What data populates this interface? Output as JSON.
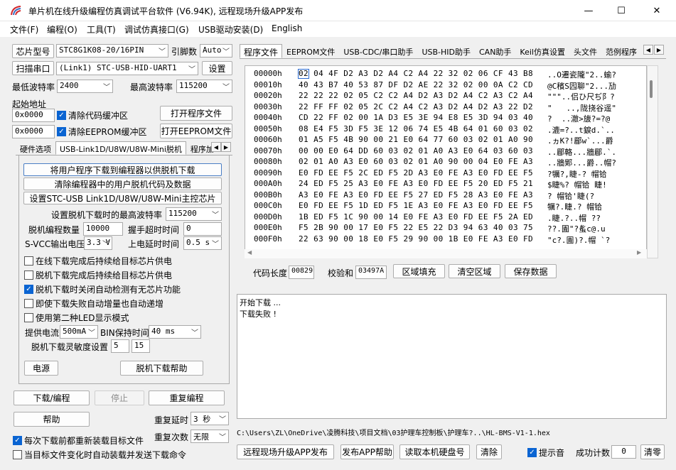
{
  "window": {
    "title": "单片机在线升级编程仿真调试平台软件 (V6.94K), 远程现场升级APP发布",
    "min": "—",
    "max": "☐",
    "close": "✕"
  },
  "menu": [
    "文件(F)",
    "编程(O)",
    "工具(T)",
    "调试仿真接口(G)",
    "USB驱动安装(D)",
    "English"
  ],
  "left": {
    "mcu_btn": "芯片型号",
    "mcu_value": "STC8G1K08-20/16PIN",
    "pin_label": "引脚数",
    "pin_value": "Auto",
    "scan_btn": "扫描串口",
    "port_value": "(Link1) STC-USB-HID-UART1",
    "settings_btn": "设置",
    "min_baud_label": "最低波特率",
    "min_baud": "2400",
    "max_baud_label": "最高波特率",
    "max_baud": "115200",
    "start_addr_label": "起始地址",
    "addr1": "0x0000",
    "clear_code_label": "清除代码缓冲区",
    "open_prog_btn": "打开程序文件",
    "addr2": "0x0000",
    "clear_eeprom_label": "清除EEPROM缓冲区",
    "open_eeprom_btn": "打开EEPROM文件",
    "tabs": [
      "硬件选项",
      "USB-Link1D/U8W/U8W-Mini脱机",
      "程序加"
    ],
    "offline_btn1": "将用户程序下载到编程器以供脱机下载",
    "offline_btn2": "清除编程器中的用户脱机代码及数据",
    "offline_btn3": "设置STC-USB Link1D/U8W/U8W-Mini主控芯片",
    "max_baud_offline_label": "设置脱机下载时的最高波特率",
    "max_baud_offline": "115200",
    "offline_count_label": "脱机编程数量",
    "offline_count": "10000",
    "handshake_label": "握手超时时间",
    "handshake": "0",
    "svcc_label": "S-VCC输出电压",
    "svcc": "3.3 V",
    "poweron_label": "上电延时时间",
    "poweron": "0.5 s",
    "opt1": "在线下载完成后持续给目标芯片供电",
    "opt2": "脱机下载完成后持续给目标芯片供电",
    "opt3": "脱机下载时关闭自动检测有无芯片功能",
    "opt4": "即使下载失败自动增量也自动递增",
    "opt5": "使用第二种LED显示模式",
    "current_label": "提供电流",
    "current": "500mA",
    "bin_label": "BIN保持时间",
    "bin": "40 ms",
    "sensitivity_label": "脱机下载灵敏度设置",
    "sens1": "5",
    "sens2": "15",
    "power_btn": "电源",
    "offline_help_btn": "脱机下载帮助",
    "download_btn": "下载/编程",
    "stop_btn": "停止",
    "reprogram_btn": "重复编程",
    "help_btn": "帮助",
    "repeat_delay_label": "重复延时",
    "repeat_delay": "3 秒",
    "repeat_count_label": "重复次数",
    "repeat_count": "无限",
    "reload_label": "每次下载前都重新装载目标文件",
    "autoload_label": "当目标文件变化时自动装载并发送下载命令"
  },
  "right": {
    "tabs": [
      "程序文件",
      "EEPROM文件",
      "USB-CDC/串口助手",
      "USB-HID助手",
      "CAN助手",
      "Keil仿真设置",
      "头文件",
      "范例程序"
    ],
    "hex_rows": [
      {
        "addr": "00000h",
        "bytes": "02 04 4F D2 A3 D2 A4 C2 A4 22 32 02 06 CF 43 B8",
        "ascii": "..O遷瓷隴\"2..蝓?"
      },
      {
        "addr": "00010h",
        "bytes": "40 43 B7 40 53 87 DF D2 AE 22 32 02 00 0A C2 CD",
        "ascii": "@C穦S囥聊\"2...劢"
      },
      {
        "addr": "00020h",
        "bytes": "22 22 22 02 05 C2 C2 A4 D2 A3 D2 A4 C2 A3 C2 A4",
        "ascii": "\"\"\"..侣ひ尺ぢ阝?"
      },
      {
        "addr": "00030h",
        "bytes": "22 FF FF 02 05 2C C2 A4 C2 A3 D2 A4 D2 A3 22 D2",
        "ascii": "\"   ..,陇挠谷遥\""
      },
      {
        "addr": "00040h",
        "bytes": "CD 22 FF 02 00 1A D3 E5 3E 94 E8 E5 3D 94 03 40",
        "ascii": "?  ..澈>旇?=?@"
      },
      {
        "addr": "00050h",
        "bytes": "08 E4 F5 3D F5 3E 12 06 74 E5 4B 64 01 60 03 02",
        "ascii": ".漉=?..t錑d.`.."
      },
      {
        "addr": "00060h",
        "bytes": "01 A5 F5 4B 90 00 21 E0 64 77 60 03 02 01 A0 90",
        "ascii": ".ヵK?!郿w`...爵"
      },
      {
        "addr": "00070h",
        "bytes": "00 00 E0 64 DD 60 03 02 01 A0 A3 E0 64 03 60 03",
        "ascii": "..郿輅...牆郿.`."
      },
      {
        "addr": "00080h",
        "bytes": "02 01 A0 A3 E0 60 03 02 01 A0 90 00 04 E0 FE A3",
        "ascii": "..牆郹...爵..帽?"
      },
      {
        "addr": "00090h",
        "bytes": "E0 FD EE F5 2C ED F5 2D A3 E0 FE A3 E0 FD EE F5",
        "ascii": "?犡?,睫-? 帽铪"
      },
      {
        "addr": "000A0h",
        "bytes": "24 ED F5 25 A3 E0 FE A3 E0 FD EE F5 20 ED F5 21",
        "ascii": "$睫%? 帽铪 睫!"
      },
      {
        "addr": "000B0h",
        "bytes": "A3 E0 FE A3 E0 FD EE F5 27 ED F5 28 A3 E0 FE A3",
        "ascii": "? 帽铪'睫(? "
      },
      {
        "addr": "000C0h",
        "bytes": "E0 FD EE F5 1D ED F5 1E A3 E0 FE A3 E0 FD EE F5",
        "ascii": "犡?.睫.? 帽铪"
      },
      {
        "addr": "000D0h",
        "bytes": "1B ED F5 1C 90 00 14 E0 FE A3 E0 FD EE F5 2A ED",
        "ascii": ".睫.?..帽 ?? "
      },
      {
        "addr": "000E0h",
        "bytes": "F5 2B 90 00 17 E0 F5 22 E5 22 D3 94 63 40 03 75",
        "ascii": "??.圊\"?蚃c@.u"
      },
      {
        "addr": "000F0h",
        "bytes": "22 63 90 00 18 E0 F5 29 90 00 1B E0 FE A3 E0 FD",
        "ascii": "\"c?.圊)?.帽 `?"
      }
    ],
    "code_len_label": "代码长度",
    "code_len": "00829",
    "checksum_label": "校验和",
    "checksum": "03497A",
    "fill_btn": "区域填充",
    "clear_btn": "清空区域",
    "save_btn": "保存数据",
    "log": [
      "开始下载 ...",
      "下载失败 !"
    ],
    "file_path": "C:\\Users\\ZL\\OneDrive\\凌腾科技\\项目文档\\03护理车控制板\\护理车?..\\HL-BMS-V1-1.hex",
    "remote_btn": "远程现场升级APP发布",
    "publish_btn": "发布APP帮助",
    "read_disk_btn": "读取本机硬盘号",
    "clear_log_btn": "清除",
    "beep_label": "提示音",
    "success_label": "成功计数",
    "success_count": "0",
    "clear_count_btn": "清零"
  }
}
